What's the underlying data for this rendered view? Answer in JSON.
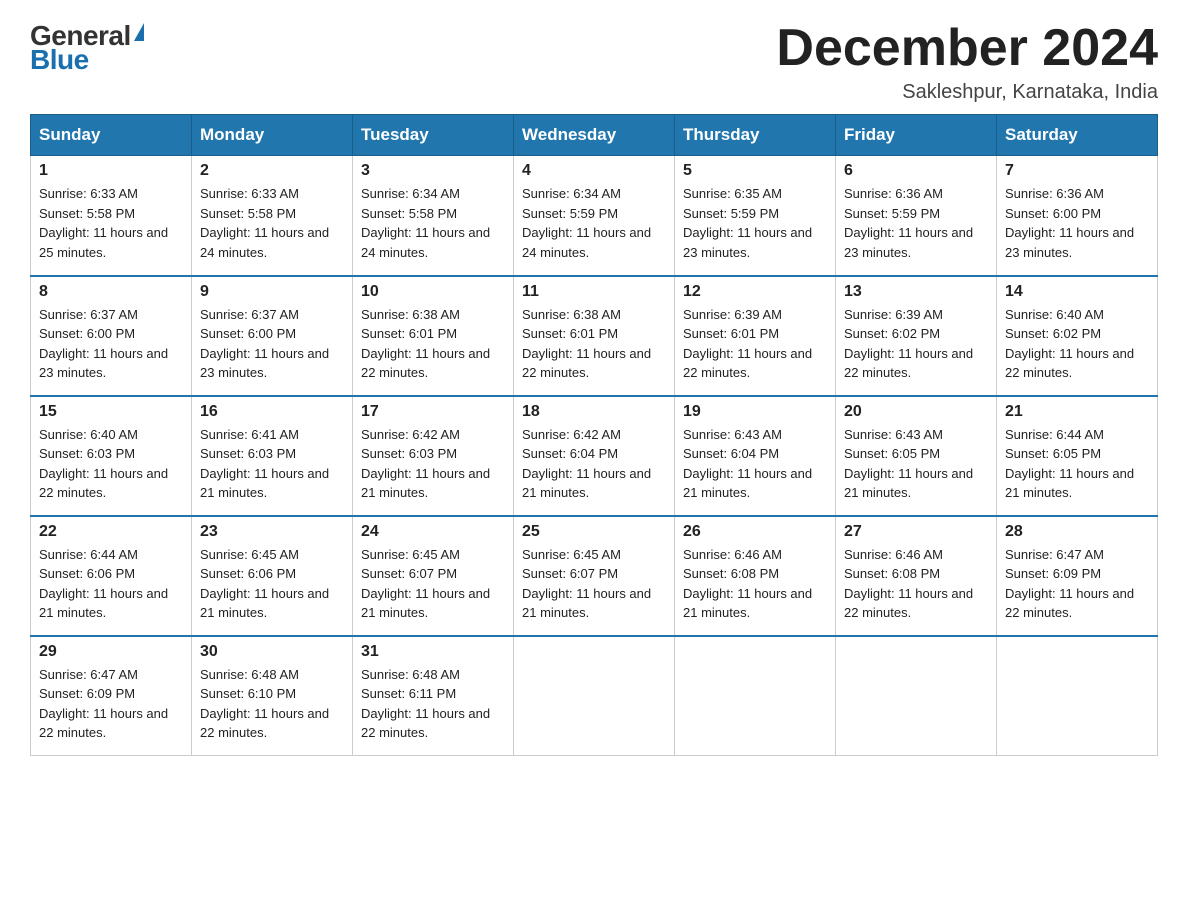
{
  "logo": {
    "general": "General",
    "blue": "Blue"
  },
  "title": "December 2024",
  "subtitle": "Sakleshpur, Karnataka, India",
  "days_header": [
    "Sunday",
    "Monday",
    "Tuesday",
    "Wednesday",
    "Thursday",
    "Friday",
    "Saturday"
  ],
  "weeks": [
    [
      {
        "day": "1",
        "sunrise": "6:33 AM",
        "sunset": "5:58 PM",
        "daylight": "11 hours and 25 minutes."
      },
      {
        "day": "2",
        "sunrise": "6:33 AM",
        "sunset": "5:58 PM",
        "daylight": "11 hours and 24 minutes."
      },
      {
        "day": "3",
        "sunrise": "6:34 AM",
        "sunset": "5:58 PM",
        "daylight": "11 hours and 24 minutes."
      },
      {
        "day": "4",
        "sunrise": "6:34 AM",
        "sunset": "5:59 PM",
        "daylight": "11 hours and 24 minutes."
      },
      {
        "day": "5",
        "sunrise": "6:35 AM",
        "sunset": "5:59 PM",
        "daylight": "11 hours and 23 minutes."
      },
      {
        "day": "6",
        "sunrise": "6:36 AM",
        "sunset": "5:59 PM",
        "daylight": "11 hours and 23 minutes."
      },
      {
        "day": "7",
        "sunrise": "6:36 AM",
        "sunset": "6:00 PM",
        "daylight": "11 hours and 23 minutes."
      }
    ],
    [
      {
        "day": "8",
        "sunrise": "6:37 AM",
        "sunset": "6:00 PM",
        "daylight": "11 hours and 23 minutes."
      },
      {
        "day": "9",
        "sunrise": "6:37 AM",
        "sunset": "6:00 PM",
        "daylight": "11 hours and 23 minutes."
      },
      {
        "day": "10",
        "sunrise": "6:38 AM",
        "sunset": "6:01 PM",
        "daylight": "11 hours and 22 minutes."
      },
      {
        "day": "11",
        "sunrise": "6:38 AM",
        "sunset": "6:01 PM",
        "daylight": "11 hours and 22 minutes."
      },
      {
        "day": "12",
        "sunrise": "6:39 AM",
        "sunset": "6:01 PM",
        "daylight": "11 hours and 22 minutes."
      },
      {
        "day": "13",
        "sunrise": "6:39 AM",
        "sunset": "6:02 PM",
        "daylight": "11 hours and 22 minutes."
      },
      {
        "day": "14",
        "sunrise": "6:40 AM",
        "sunset": "6:02 PM",
        "daylight": "11 hours and 22 minutes."
      }
    ],
    [
      {
        "day": "15",
        "sunrise": "6:40 AM",
        "sunset": "6:03 PM",
        "daylight": "11 hours and 22 minutes."
      },
      {
        "day": "16",
        "sunrise": "6:41 AM",
        "sunset": "6:03 PM",
        "daylight": "11 hours and 21 minutes."
      },
      {
        "day": "17",
        "sunrise": "6:42 AM",
        "sunset": "6:03 PM",
        "daylight": "11 hours and 21 minutes."
      },
      {
        "day": "18",
        "sunrise": "6:42 AM",
        "sunset": "6:04 PM",
        "daylight": "11 hours and 21 minutes."
      },
      {
        "day": "19",
        "sunrise": "6:43 AM",
        "sunset": "6:04 PM",
        "daylight": "11 hours and 21 minutes."
      },
      {
        "day": "20",
        "sunrise": "6:43 AM",
        "sunset": "6:05 PM",
        "daylight": "11 hours and 21 minutes."
      },
      {
        "day": "21",
        "sunrise": "6:44 AM",
        "sunset": "6:05 PM",
        "daylight": "11 hours and 21 minutes."
      }
    ],
    [
      {
        "day": "22",
        "sunrise": "6:44 AM",
        "sunset": "6:06 PM",
        "daylight": "11 hours and 21 minutes."
      },
      {
        "day": "23",
        "sunrise": "6:45 AM",
        "sunset": "6:06 PM",
        "daylight": "11 hours and 21 minutes."
      },
      {
        "day": "24",
        "sunrise": "6:45 AM",
        "sunset": "6:07 PM",
        "daylight": "11 hours and 21 minutes."
      },
      {
        "day": "25",
        "sunrise": "6:45 AM",
        "sunset": "6:07 PM",
        "daylight": "11 hours and 21 minutes."
      },
      {
        "day": "26",
        "sunrise": "6:46 AM",
        "sunset": "6:08 PM",
        "daylight": "11 hours and 21 minutes."
      },
      {
        "day": "27",
        "sunrise": "6:46 AM",
        "sunset": "6:08 PM",
        "daylight": "11 hours and 22 minutes."
      },
      {
        "day": "28",
        "sunrise": "6:47 AM",
        "sunset": "6:09 PM",
        "daylight": "11 hours and 22 minutes."
      }
    ],
    [
      {
        "day": "29",
        "sunrise": "6:47 AM",
        "sunset": "6:09 PM",
        "daylight": "11 hours and 22 minutes."
      },
      {
        "day": "30",
        "sunrise": "6:48 AM",
        "sunset": "6:10 PM",
        "daylight": "11 hours and 22 minutes."
      },
      {
        "day": "31",
        "sunrise": "6:48 AM",
        "sunset": "6:11 PM",
        "daylight": "11 hours and 22 minutes."
      },
      null,
      null,
      null,
      null
    ]
  ]
}
